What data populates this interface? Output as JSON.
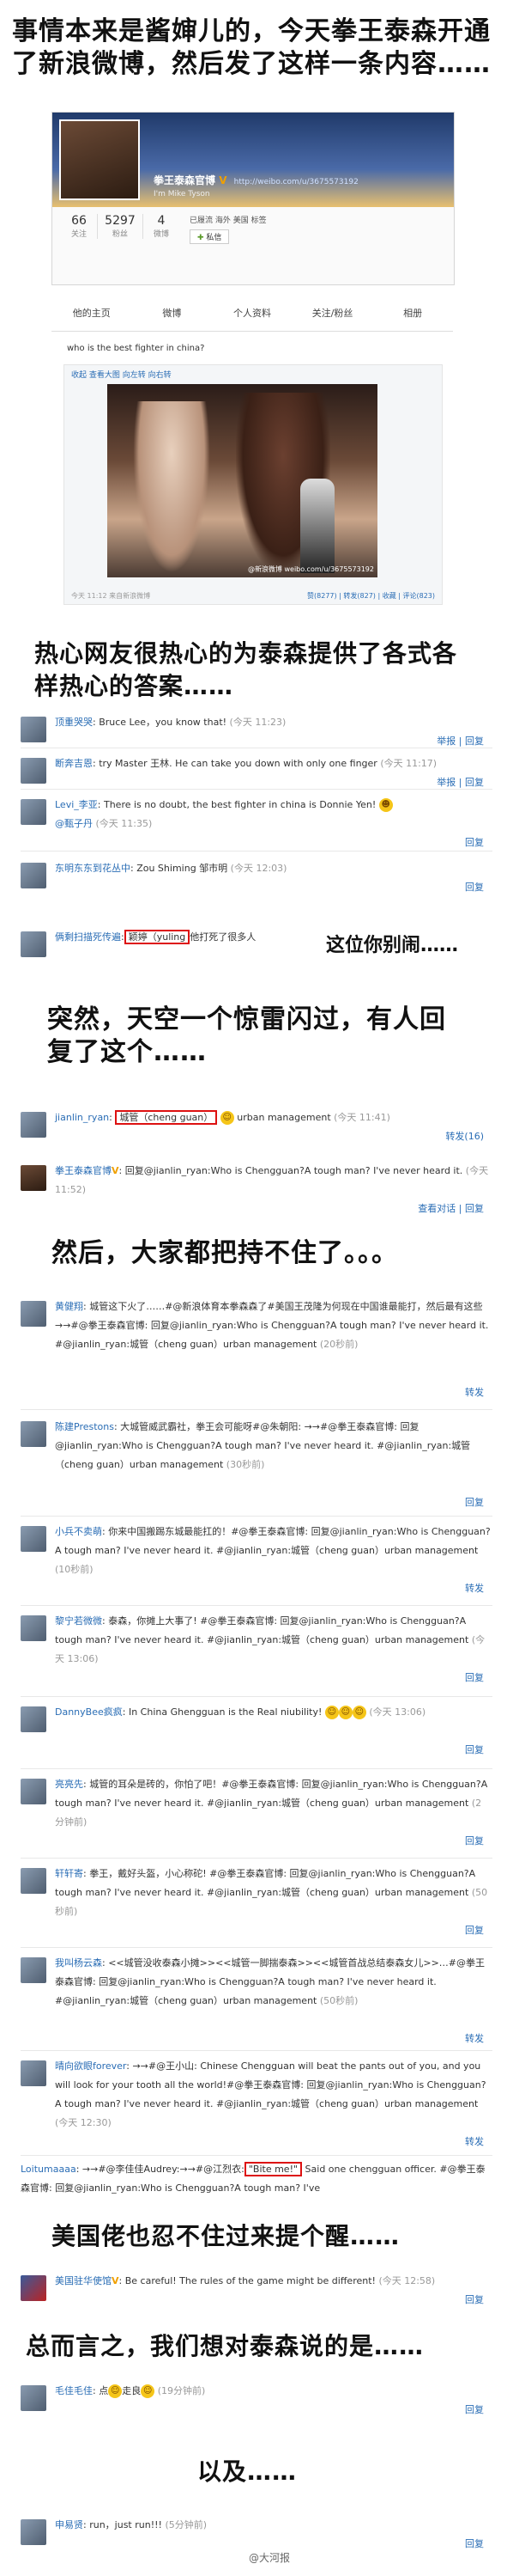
{
  "captions": {
    "intro": "事情本来是酱婶儿的，今天拳王泰森开通了新浪微博，然后发了这样一条内容……",
    "answers": "热心网友很热心的为泰森提供了各式各样热心的答案……",
    "this_one": "这位你别闹……",
    "suddenly": "突然，天空一个惊雷闪过，有人回复了这个……",
    "then": "然后，大家都把持不住了。。。",
    "american": "美国佬也忍不住过来提个醒……",
    "in_short": "总而言之，我们想对泰森说的是……",
    "and": "以及……"
  },
  "profile": {
    "name": "拳王泰森官博",
    "url": "http://weibo.com/u/3675573192",
    "sub": "I'm Mike Tyson",
    "meta": "已履流  海外 美国  标签",
    "follow_btn": "私信",
    "stats": [
      {
        "num": "66",
        "label": "关注"
      },
      {
        "num": "5297",
        "label": "粉丝"
      },
      {
        "num": "4",
        "label": "微博"
      }
    ],
    "tabs": [
      "他的主页",
      "微博",
      "个人资料",
      "关注/粉丝",
      "相册"
    ]
  },
  "post": {
    "text": "who is the best fighter in china?",
    "img_tools": "收起  查看大图  向左转  向右转",
    "photo_watermark": "@新浪微博 weibo.com/u/3675573192",
    "time": "今天 11:12  来自新浪微博",
    "actions": "赞(8277) | 转发(827) | 收藏 | 评论(823)"
  },
  "answers": [
    {
      "user": "顶重哭哭",
      "text": ": Bruce Lee，you know that!",
      "time": "(今天 11:23)",
      "acts": "举报 | 回复"
    },
    {
      "user": "断奔吉恩",
      "text": ": try Master 王林. He can take you down with only one finger",
      "time": "(今天 11:17)",
      "acts": "举报 | 回复"
    },
    {
      "user": "Levi_李亚",
      "text": ": There is no doubt, the best fighter in china is Donnie Yen!",
      "user2": "@甄子丹",
      "time": "(今天 11:35)",
      "acts": "回复"
    },
    {
      "user": "东明东东到花丛中",
      "text": ": Zou Shiming 邹市明",
      "time": "(今天 12:03)",
      "acts": "回复"
    },
    {
      "user": "俩剩扫描死传遍",
      "pre": ":",
      "boxed": "颖婷（yuling",
      "text": "他打死了很多人",
      "acts": ""
    }
  ],
  "reply": {
    "user": "jianlin_ryan",
    "boxed": "城管（cheng guan）",
    "text": "urban management",
    "time": "(今天 11:41)",
    "acts": "转发(16)",
    "tyson_user": "拳王泰森官博",
    "tyson_text": ": 回复@jianlin_ryan:Who is Chengguan?A tough man? I've never heard it.",
    "tyson_time": "(今天 11:52)",
    "tyson_acts": "查看对话 | 回复"
  },
  "chain": [
    {
      "user": "黄健翔",
      "text": ": 城管这下火了……#@新浪体育本拳森森了#美国王茂隆为何现在中国谁最能打，然后最有这些→→#@拳王泰森官博: 回复@jianlin_ryan:Who is Chengguan?A tough man? I've never heard it. #@jianlin_ryan:城管（cheng guan）urban management",
      "time": "(20秒前)",
      "acts": "转发"
    },
    {
      "user": "陈建Prestons",
      "text": ": 大城管威武霸社，拳王会可能呀#@朱朝阳: →→#@拳王泰森官博: 回复@jianlin_ryan:Who is Chengguan?A tough man? I've never heard it. #@jianlin_ryan:城管（cheng guan）urban management",
      "time": "(30秒前)",
      "acts": "回复"
    },
    {
      "user": "小兵不卖萌",
      "text": ": 你来中国搬踢东城最能扛的！#@拳王泰森官博: 回复@jianlin_ryan:Who is Chengguan?A tough man? I've never heard it. #@jianlin_ryan:城管（cheng guan）urban management",
      "time": "(10秒前)",
      "acts": "转发"
    },
    {
      "user": "黎宁若微微",
      "text": ": 泰森，你摊上大事了! #@拳王泰森官博: 回复@jianlin_ryan:Who is Chengguan?A tough man? I've never heard it. #@jianlin_ryan:城管（cheng guan）urban management",
      "time": "(今天 13:06)",
      "acts": "回复"
    },
    {
      "user": "DannyBee疯疯",
      "text": ": In China Ghengguan is the Real niubility!",
      "time": "(今天 13:06)",
      "acts": "回复"
    },
    {
      "user": "亮亮先",
      "text": ": 城管的耳朵是砖的，你怕了吧！#@拳王泰森官博: 回复@jianlin_ryan:Who is Chengguan?A tough man? I've never heard it. #@jianlin_ryan:城管（cheng guan）urban management",
      "time": "(2分钟前)",
      "acts": "回复"
    },
    {
      "user": "轩轩寄",
      "text": ": 拳王，戴好头盔，小心称砣! #@拳王泰森官博: 回复@jianlin_ryan:Who is Chengguan?A tough man? I've never heard it. #@jianlin_ryan:城管（cheng guan）urban management",
      "time": "(50秒前)",
      "acts": "回复"
    },
    {
      "user": "我叫杨云森",
      "text": ": <<城管没收泰森小摊>><<城管一脚揣泰森>><<城管首战总结泰森女儿>>…#@拳王泰森官博: 回复@jianlin_ryan:Who is Chengguan?A tough man? I've never heard it. #@jianlin_ryan:城管（cheng guan）urban management",
      "time": "(50秒前)",
      "acts": "转发"
    },
    {
      "user": "晴向欲眼forever",
      "text": ": →→#@王小山: Chinese Chengguan will beat the pants out of you, and you will look for your tooth all the world!#@拳王泰森官博: 回复@jianlin_ryan:Who is Chengguan?A tough man? I've never heard it. #@jianlin_ryan:城管（cheng guan）urban management",
      "time": "(今天 12:30)",
      "acts": "转发"
    }
  ],
  "last_chain": {
    "user": "Loitumaaaa",
    "pre": ": →→#@李佳佳Audrey:→→#@江烈衣:",
    "boxed": "\"Bite me!\"",
    "text": " Said one chengguan officer. #@拳王泰森官博: 回复@jianlin_ryan:Who is Chengguan?A tough man? I've"
  },
  "american": {
    "user": "美国驻华使馆",
    "text": ": Be careful! The rules of the game might be different!",
    "time": "(今天 12:58)",
    "acts": "回复"
  },
  "final1": {
    "user": "毛佳毛佳",
    "text": ": 点",
    "text2": "走良",
    "time": "(19分钟前)",
    "acts": "回复"
  },
  "final2": {
    "user": "申易贤",
    "text": ": run，just run!!!",
    "time": "(5分钟前)",
    "acts": "回复"
  },
  "watermark": "@大河报"
}
